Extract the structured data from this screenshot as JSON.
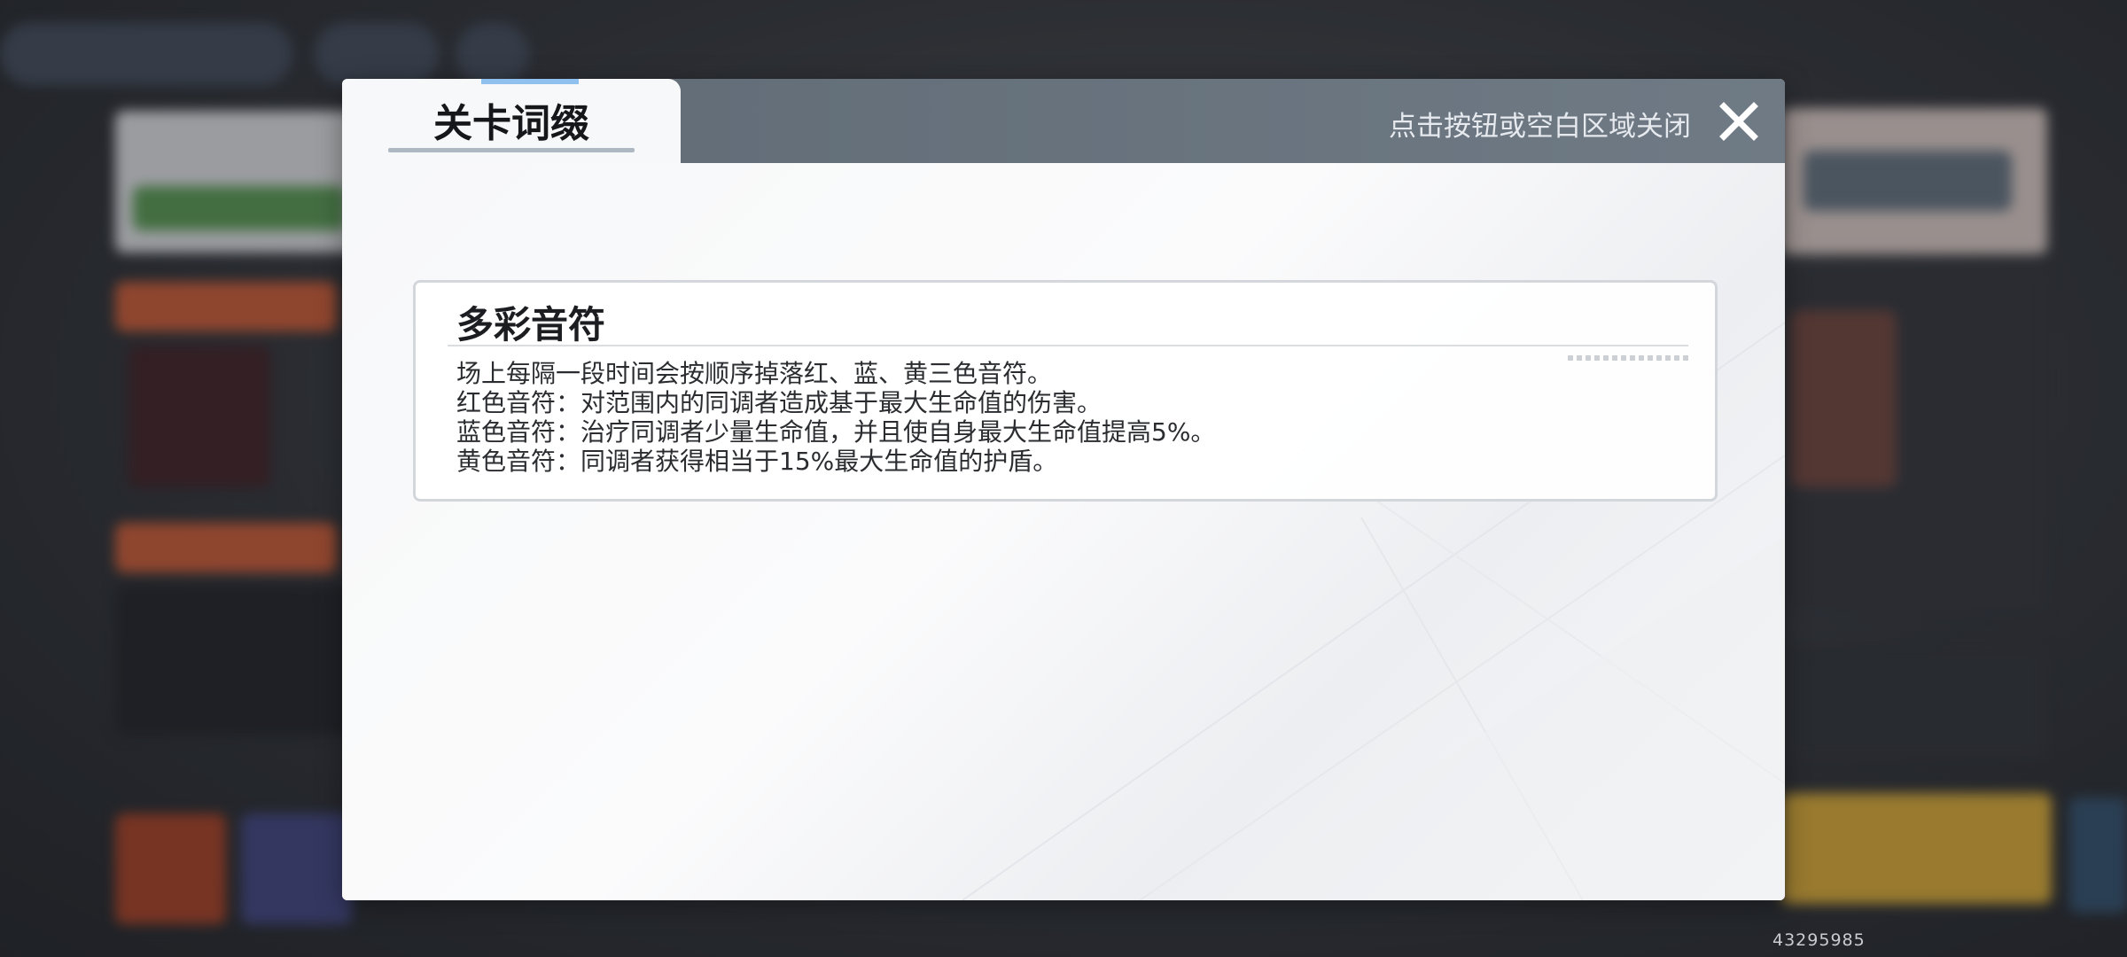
{
  "modal": {
    "tab_label": "关卡词缀",
    "close_hint": "点击按钮或空白区域关闭"
  },
  "affix": {
    "title": "多彩音符",
    "lines": [
      "场上每隔一段时间会按顺序掉落红、蓝、黄三色音符。",
      "红色音符：对范围内的同调者造成基于最大生命值的伤害。",
      "蓝色音符：治疗同调者少量生命值，并且使自身最大生命值提高5%。",
      "黄色音符：同调者获得相当于15%最大生命值的护盾。"
    ]
  },
  "footer": {
    "build_id": "43295985"
  },
  "colors": {
    "header_bg": "#6a7580",
    "body_bg": "#f5f6f8",
    "tab_accent": "#8fc0ee",
    "text_primary": "#1b1d20"
  }
}
